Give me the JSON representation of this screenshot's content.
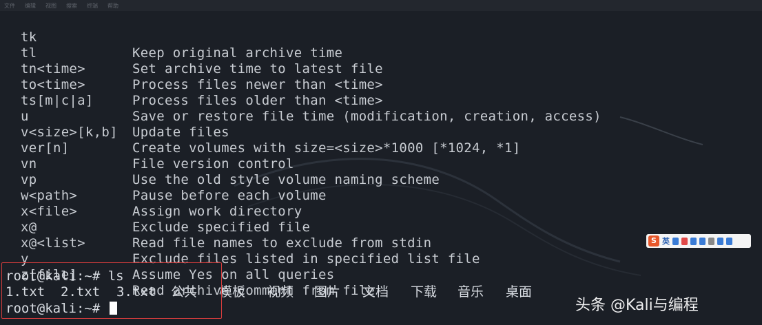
{
  "menubar": {
    "items": [
      "文件",
      "编辑",
      "视图",
      "搜索",
      "终端",
      "帮助"
    ]
  },
  "options": [
    {
      "key": "tk",
      "desc": "Keep original archive time"
    },
    {
      "key": "tl",
      "desc": "Set archive time to latest file"
    },
    {
      "key": "tn<time>",
      "desc": "Process files newer than <time>"
    },
    {
      "key": "to<time>",
      "desc": "Process files older than <time>"
    },
    {
      "key": "ts[m|c|a]",
      "desc": "Save or restore file time (modification, creation, access)"
    },
    {
      "key": "u",
      "desc": "Update files"
    },
    {
      "key": "v<size>[k,b]",
      "desc": "Create volumes with size=<size>*1000 [*1024, *1]"
    },
    {
      "key": "ver[n]",
      "desc": "File version control"
    },
    {
      "key": "vn",
      "desc": "Use the old style volume naming scheme"
    },
    {
      "key": "vp",
      "desc": "Pause before each volume"
    },
    {
      "key": "w<path>",
      "desc": "Assign work directory"
    },
    {
      "key": "x<file>",
      "desc": "Exclude specified file"
    },
    {
      "key": "x@",
      "desc": "Read file names to exclude from stdin"
    },
    {
      "key": "x@<list>",
      "desc": "Exclude files listed in specified list file"
    },
    {
      "key": "y",
      "desc": "Assume Yes on all queries"
    },
    {
      "key": "z[file]",
      "desc": "Read archive comment from file"
    }
  ],
  "session": {
    "command_line": "root@kali:~# ls",
    "ls_output": [
      "1.txt",
      "2.txt",
      "3.txt",
      "公共",
      "模板",
      "视频",
      "图片",
      "文档",
      "下载",
      "音乐",
      "桌面"
    ],
    "prompt": "root@kali:~# "
  },
  "watermark": "头条 @Kali与编程",
  "ime": {
    "logo": "S",
    "text": "英",
    "icon_colors": [
      "#3a7bd5",
      "#e04848",
      "#3a7bd5",
      "#3a7bd5",
      "#888888",
      "#3a7bd5",
      "#3a7bd5",
      "#3a7bd5"
    ]
  },
  "colors": {
    "background": "#1b1f26",
    "text": "#c8ccd2",
    "highlight": "#d23c3c"
  }
}
